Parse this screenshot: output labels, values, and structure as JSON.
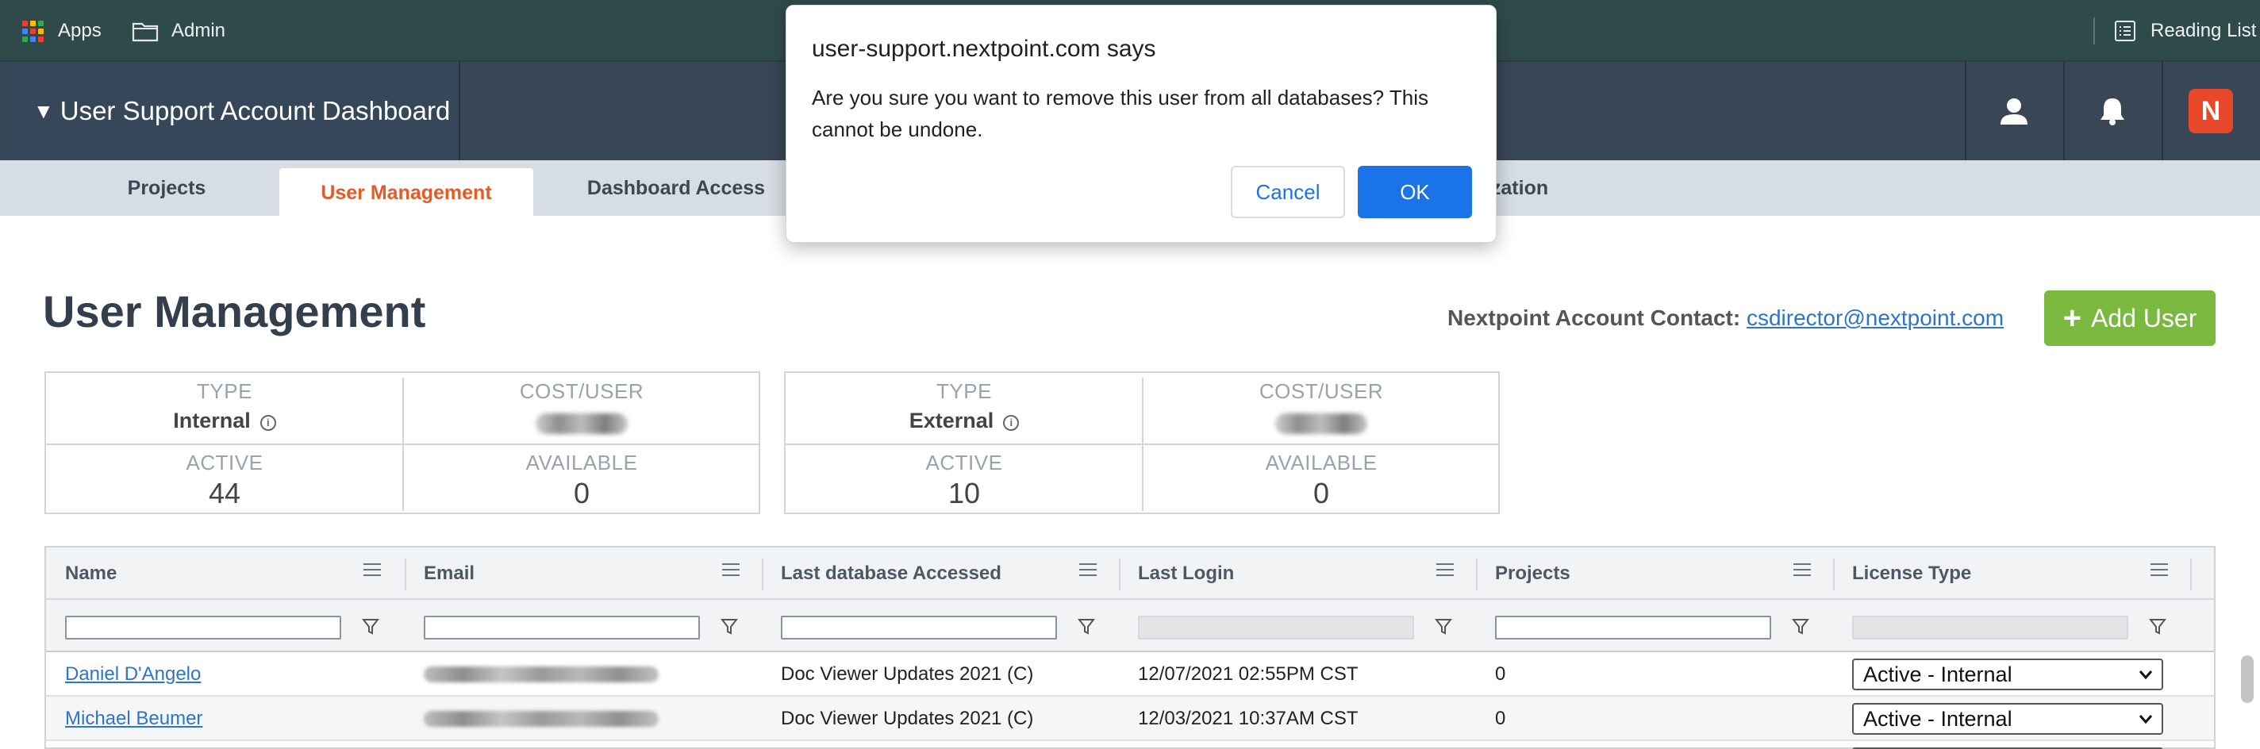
{
  "browser": {
    "bookmarks": [
      {
        "label": "Apps",
        "icon": "apps-grid-icon"
      },
      {
        "label": "Admin",
        "icon": "folder-icon"
      }
    ],
    "reading_list": "Reading List"
  },
  "header": {
    "dashboard_title": "User Support Account Dashboard",
    "caret": "▼",
    "logo_text": "N"
  },
  "tabs": [
    {
      "label": "Projects",
      "active": false
    },
    {
      "label": "User Management",
      "active": true
    },
    {
      "label": "Dashboard Access",
      "active": false
    },
    {
      "label": "zation",
      "active": false
    }
  ],
  "page": {
    "title": "User Management",
    "contact_label": "Nextpoint Account Contact:",
    "contact_email": "csdirector@nextpoint.com",
    "add_user_label": "Add User"
  },
  "cards": [
    {
      "type_label": "TYPE",
      "type_value": "Internal",
      "cost_label": "COST/USER",
      "active_label": "ACTIVE",
      "active_value": "44",
      "available_label": "AVAILABLE",
      "available_value": "0"
    },
    {
      "type_label": "TYPE",
      "type_value": "External",
      "cost_label": "COST/USER",
      "active_label": "ACTIVE",
      "active_value": "10",
      "available_label": "AVAILABLE",
      "available_value": "0"
    }
  ],
  "grid": {
    "columns": [
      "Name",
      "Email",
      "Last database Accessed",
      "Last Login",
      "Projects",
      "License Type"
    ],
    "rows": [
      {
        "name": "Daniel D'Angelo",
        "database": "Doc Viewer Updates 2021 (C)",
        "last_login": "12/07/2021 02:55PM CST",
        "projects": "0",
        "license": "Active - Internal"
      },
      {
        "name": "Michael Beumer",
        "database": "Doc Viewer Updates 2021 (C)",
        "last_login": "12/03/2021 10:37AM CST",
        "projects": "0",
        "license": "Active - Internal"
      }
    ]
  },
  "dialog": {
    "title": "user-support.nextpoint.com says",
    "message": "Are you sure you want to remove this user from all databases? This cannot be undone.",
    "cancel_label": "Cancel",
    "ok_label": "OK"
  },
  "colors": {
    "accent_orange": "#e65a26",
    "add_green": "#7ab83f",
    "dialog_blue": "#1a73e8",
    "header_navy": "#384656"
  }
}
